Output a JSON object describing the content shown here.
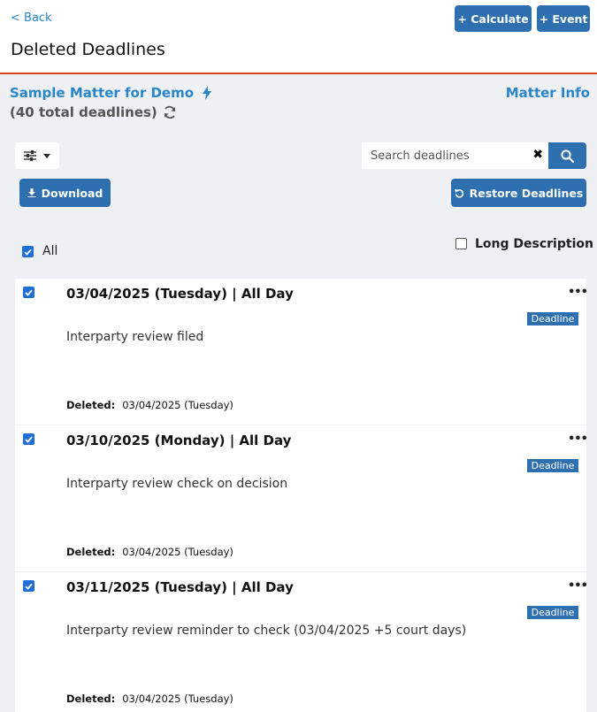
{
  "header": {
    "back_label": "< Back",
    "title": "Deleted Deadlines",
    "calculate_label": "+ Calculate",
    "event_label": "+ Event"
  },
  "matter": {
    "name": "Sample Matter for Demo",
    "info_label": "Matter Info",
    "total_text": "(40 total deadlines)"
  },
  "toolbar": {
    "search_placeholder": "Search deadlines",
    "clear_glyph": "✖",
    "download_label": "Download",
    "restore_label": "Restore Deadlines"
  },
  "selection": {
    "all_label": "All",
    "all_checked": true,
    "long_description_label": "Long Description",
    "long_description_checked": false
  },
  "deleted_label": "Deleted:",
  "more_glyph": "•••",
  "deadlines": [
    {
      "checked": true,
      "date_line": "03/04/2025 (Tuesday)  |  All Day",
      "badge": "Deadline",
      "description": "Interparty review filed",
      "deleted_date": "03/04/2025 (Tuesday)"
    },
    {
      "checked": true,
      "date_line": "03/10/2025 (Monday)  |  All Day",
      "badge": "Deadline",
      "description": "Interparty review check on decision",
      "deleted_date": "03/04/2025 (Tuesday)"
    },
    {
      "checked": true,
      "date_line": "03/11/2025 (Tuesday)  |  All Day",
      "badge": "Deadline",
      "description": "Interparty review reminder to check (03/04/2025 +5 court days)",
      "deleted_date": "03/04/2025 (Tuesday)"
    }
  ],
  "colors": {
    "accent_blue": "#2e6fb0",
    "link_blue": "#2a86c9",
    "header_rule": "#d9432f",
    "checkbox_blue": "#1f6fd6"
  }
}
